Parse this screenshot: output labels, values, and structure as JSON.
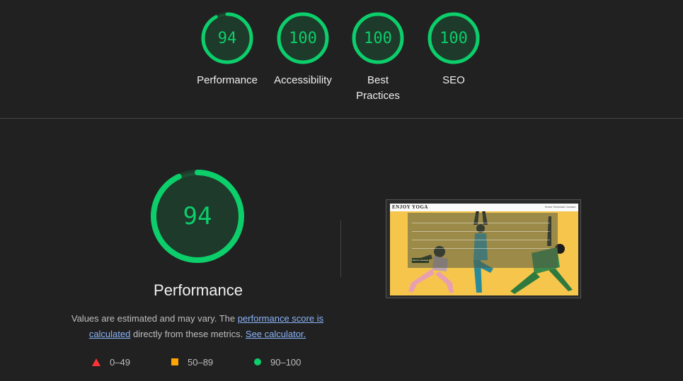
{
  "categories": [
    {
      "label": "Performance",
      "score": "94",
      "value": 94
    },
    {
      "label": "Accessibility",
      "score": "100",
      "value": 100
    },
    {
      "label": "Best Practices",
      "score": "100",
      "value": 100
    },
    {
      "label": "SEO",
      "score": "100",
      "value": 100
    }
  ],
  "main": {
    "score": "94",
    "value": 94,
    "title": "Performance",
    "desc_prefix": "Values are estimated and may vary. The ",
    "link_score": "performance score is calculated",
    "desc_middle": " directly from these metrics. ",
    "link_calculator": "See calculator."
  },
  "legend": [
    {
      "range": "0–49",
      "icon": "triangle-icon",
      "color": "#ff3333"
    },
    {
      "range": "50–89",
      "icon": "square-icon",
      "color": "#ffa400"
    },
    {
      "range": "90–100",
      "icon": "circle-icon",
      "color": "#0cce6b"
    }
  ],
  "thumbnail": {
    "brand": "ENJOY YOGA",
    "nav": "Home  Schedule  Contact",
    "button": "Send a message"
  },
  "colors": {
    "pass": "#0cce6b",
    "average": "#ffa400",
    "fail": "#ff3333",
    "background": "#212121"
  }
}
